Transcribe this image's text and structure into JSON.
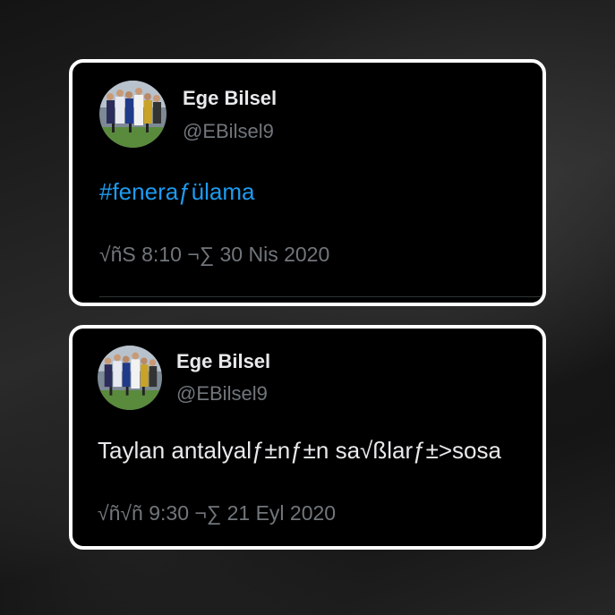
{
  "tweets": [
    {
      "author_name": "Ege Bilsel",
      "author_handle": "@EBilsel9",
      "text": "#feneraƒülama",
      "timestamp": "√ñS 8:10 ¬∑ 30 Nis 2020",
      "text_color": "#1d9bf0"
    },
    {
      "author_name": "Ege Bilsel",
      "author_handle": "@EBilsel9",
      "text": "Taylan antalyalƒ±nƒ±n sa√ßlarƒ±>sosa",
      "timestamp": "√ñ√ñ 9:30 ¬∑ 21 Eyl 2020",
      "text_color": "#e7e9ea"
    }
  ],
  "colors": {
    "card_background": "#000000",
    "card_border": "#ffffff",
    "name": "#e7e9ea",
    "secondary_text": "#71767b",
    "hashtag": "#1d9bf0"
  }
}
